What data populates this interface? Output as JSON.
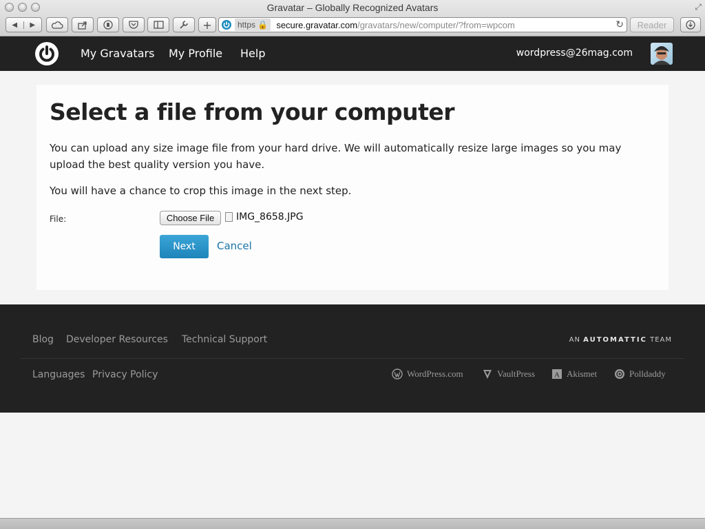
{
  "browser": {
    "window_title": "Gravatar – Globally Recognized Avatars",
    "address": {
      "protocol": "https",
      "host": "secure.gravatar.com",
      "path": "/gravatars/new/computer/?from=wpcom"
    },
    "reader_label": "Reader"
  },
  "header": {
    "nav": [
      {
        "label": "My Gravatars"
      },
      {
        "label": "My Profile"
      },
      {
        "label": "Help"
      }
    ],
    "user_email": "wordpress@26mag.com"
  },
  "main": {
    "title": "Select a file from your computer",
    "intro": "You can upload any size image file from your hard drive. We will automatically resize large images so you may upload the best quality version you have.",
    "crop_note": "You will have a chance to crop this image in the next step.",
    "file_label": "File:",
    "choose_button": "Choose File",
    "selected_file": "IMG_8658.JPG",
    "next_button": "Next",
    "cancel_link": "Cancel"
  },
  "footer": {
    "links_top": [
      {
        "label": "Blog"
      },
      {
        "label": "Developer Resources"
      },
      {
        "label": "Technical Support"
      }
    ],
    "links_bottom": [
      {
        "label": "Languages"
      },
      {
        "label": "Privacy Policy"
      }
    ],
    "automattic_prefix": "AN",
    "automattic_name": "AUTOMATTIC",
    "automattic_suffix": "TEAM",
    "brands": [
      {
        "label": "WordPress.com",
        "icon": "wordpress-icon"
      },
      {
        "label": "VaultPress",
        "icon": "vaultpress-icon"
      },
      {
        "label": "Akismet",
        "icon": "akismet-icon"
      },
      {
        "label": "Polldaddy",
        "icon": "polldaddy-icon"
      }
    ]
  },
  "colors": {
    "header_bg": "#222222",
    "accent_blue": "#2a94c8",
    "link_blue": "#1a75a5"
  }
}
